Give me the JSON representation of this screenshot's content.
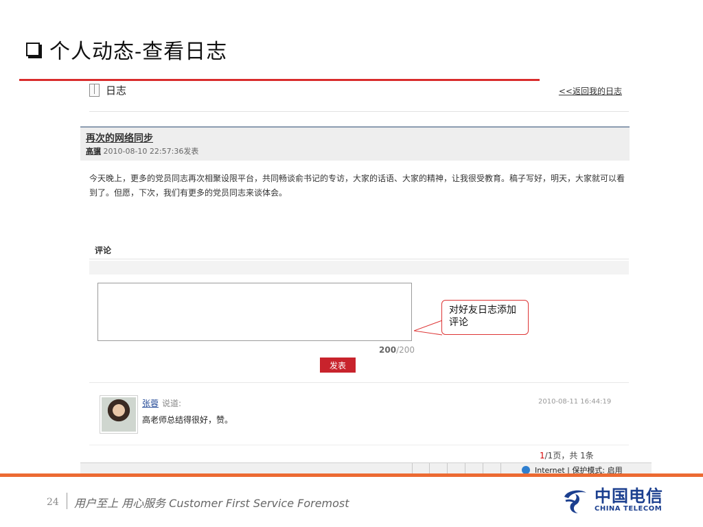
{
  "slide": {
    "title": "个人动态-查看日志",
    "page_number": "24",
    "slogan": "用户至上 用心服务 Customer First Service Foremost",
    "logo_cn": "中国电信",
    "logo_en": "CHINA TELECOM",
    "accent_color": "#d92b2b",
    "footer_color": "#ec6a32",
    "brand_color": "#1b3f8f"
  },
  "blog": {
    "header_title": "日志",
    "back_link": "<<返回我的日志",
    "post": {
      "title": "再次的网络同步",
      "author": "高骥",
      "datetime": "2010-08-10 22:57:36",
      "published_suffix": "发表",
      "body": "今天晚上，更多的党员同志再次相聚设限平台，共同畅谈俞书记的专访，大家的话语、大家的精神，让我很受教育。稿子写好，明天，大家就可以看到了。但愿，下次，我们有更多的党员同志来谈体会。"
    },
    "comments": {
      "label": "评论",
      "input_value": "",
      "counter_current": "200",
      "counter_total": "/200",
      "submit_label": "发表",
      "items": [
        {
          "user": "张蓉",
          "says": "说道:",
          "time": "2010-08-11 16:44:19",
          "text": "高老师总结得很好，赞。"
        }
      ]
    },
    "pager": {
      "current": "1",
      "rest": "/1页，共 1条"
    }
  },
  "status_bar": {
    "text": "Internet | 保护模式: 启用"
  },
  "callout": {
    "text": "对好友日志添加评论"
  }
}
